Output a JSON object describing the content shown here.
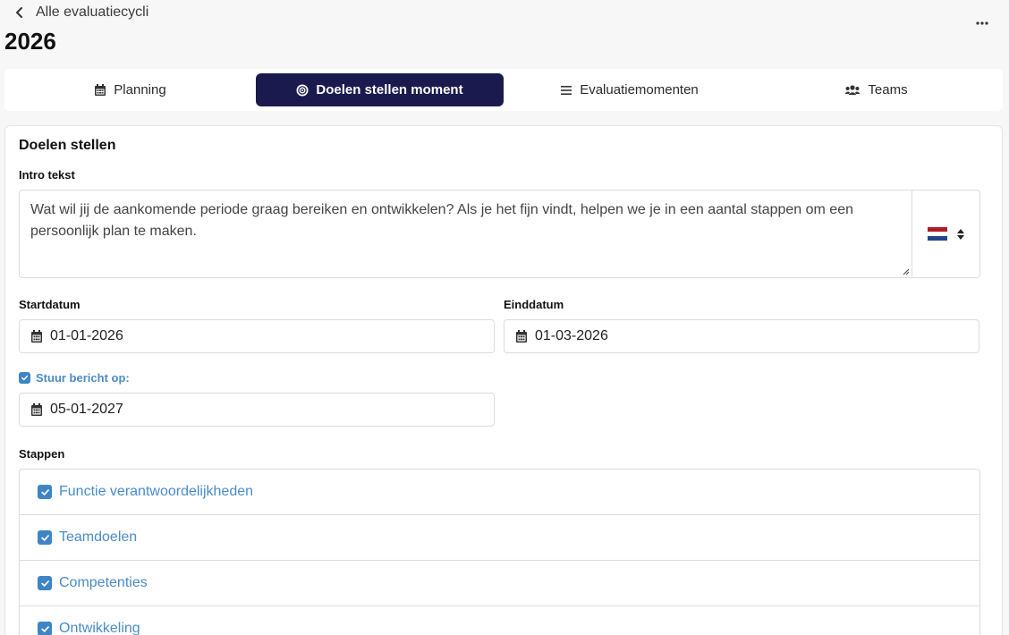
{
  "header": {
    "back_label": "Alle evaluatiecycli",
    "title": "2026"
  },
  "tabs": [
    {
      "label": "Planning",
      "icon": "calendar-icon",
      "active": false
    },
    {
      "label": "Doelen stellen moment",
      "icon": "target-icon",
      "active": true
    },
    {
      "label": "Evaluatiemomenten",
      "icon": "list-icon",
      "active": false
    },
    {
      "label": "Teams",
      "icon": "users-icon",
      "active": false
    }
  ],
  "form": {
    "section_title": "Doelen stellen",
    "intro_label": "Intro tekst",
    "intro_text": "Wat wil jij de aankomende periode graag bereiken en ontwikkelen? Als je het fijn vindt, helpen we je in een aantal stappen om een persoonlijk plan te maken.",
    "language": {
      "icon": "dutch-flag-icon",
      "colors": [
        "#ae1c28",
        "#ffffff",
        "#21468b"
      ]
    },
    "start_label": "Startdatum",
    "start_value": "01-01-2026",
    "end_label": "Einddatum",
    "end_value": "01-03-2026",
    "notify_label": "Stuur bericht op:",
    "notify_checked": true,
    "notify_value": "05-01-2027",
    "steps_label": "Stappen",
    "steps": [
      {
        "label": "Functie verantwoordelijkheden",
        "checked": true
      },
      {
        "label": "Teamdoelen",
        "checked": true
      },
      {
        "label": "Competenties",
        "checked": true
      },
      {
        "label": "Ontwikkeling",
        "checked": true
      }
    ]
  },
  "colors": {
    "accent": "#1b1a4f",
    "link_blue": "#4a8bc9",
    "checkbox_blue": "#3d85c6"
  }
}
